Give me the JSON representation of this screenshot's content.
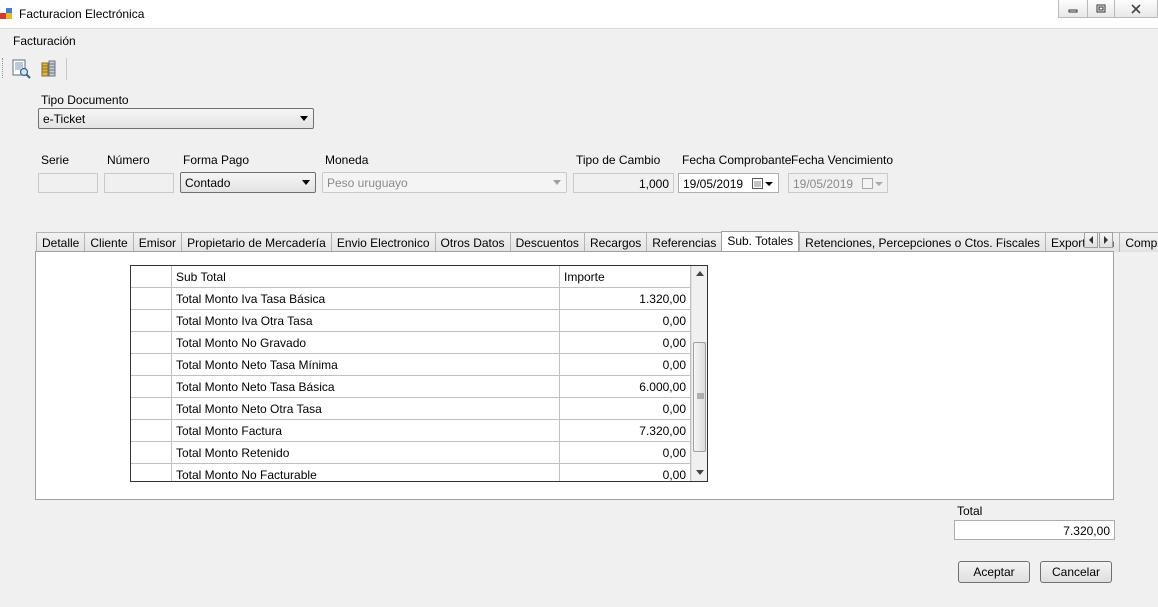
{
  "window": {
    "title": "Facturacion Electrónica",
    "minimize_icon": "minimize-icon",
    "maximize_icon": "maximize-icon",
    "close_icon": "close-icon"
  },
  "menu": {
    "facturacion": "Facturación"
  },
  "toolbar": {
    "icons": [
      "document-preview-icon",
      "coins-icon"
    ]
  },
  "tipo_documento": {
    "label": "Tipo Documento",
    "value": "e-Ticket"
  },
  "fields": {
    "serie_label": "Serie",
    "numero_label": "Número",
    "forma_pago_label": "Forma Pago",
    "forma_pago_value": "Contado",
    "moneda_label": "Moneda",
    "moneda_value": "Peso uruguayo",
    "tipo_cambio_label": "Tipo de Cambio",
    "tipo_cambio_value": "1,000",
    "fecha_comprobante_label": "Fecha Comprobante",
    "fecha_comprobante_value": "19/05/2019",
    "fecha_vencimiento_label": "Fecha Vencimiento",
    "fecha_vencimiento_value": "19/05/2019"
  },
  "tabs": [
    "Detalle",
    "Cliente",
    "Emisor",
    "Propietario de Mercadería",
    "Envio Electronico",
    "Otros Datos",
    "Descuentos",
    "Recargos",
    "Referencias",
    "Sub. Totales",
    "Retenciones, Percepciones o Ctos. Fiscales",
    "Exportación",
    "Complemen"
  ],
  "active_tab": "Sub. Totales",
  "grid": {
    "columns": [
      "Sub Total",
      "Importe"
    ],
    "rows": [
      [
        "Total Monto Iva Tasa Básica",
        "1.320,00"
      ],
      [
        "Total Monto Iva Otra Tasa",
        "0,00"
      ],
      [
        "Total Monto No Gravado",
        "0,00"
      ],
      [
        "Total Monto Neto Tasa Mínima",
        "0,00"
      ],
      [
        "Total Monto Neto Tasa Básica",
        "6.000,00"
      ],
      [
        "Total Monto Neto Otra Tasa",
        "0,00"
      ],
      [
        "Total Monto Factura",
        "7.320,00"
      ],
      [
        "Total Monto Retenido",
        "0,00"
      ],
      [
        "Total Monto No Facturable",
        "0,00"
      ]
    ]
  },
  "total": {
    "label": "Total",
    "value": "7.320,00"
  },
  "buttons": {
    "aceptar": "Aceptar",
    "cancelar": "Cancelar"
  }
}
